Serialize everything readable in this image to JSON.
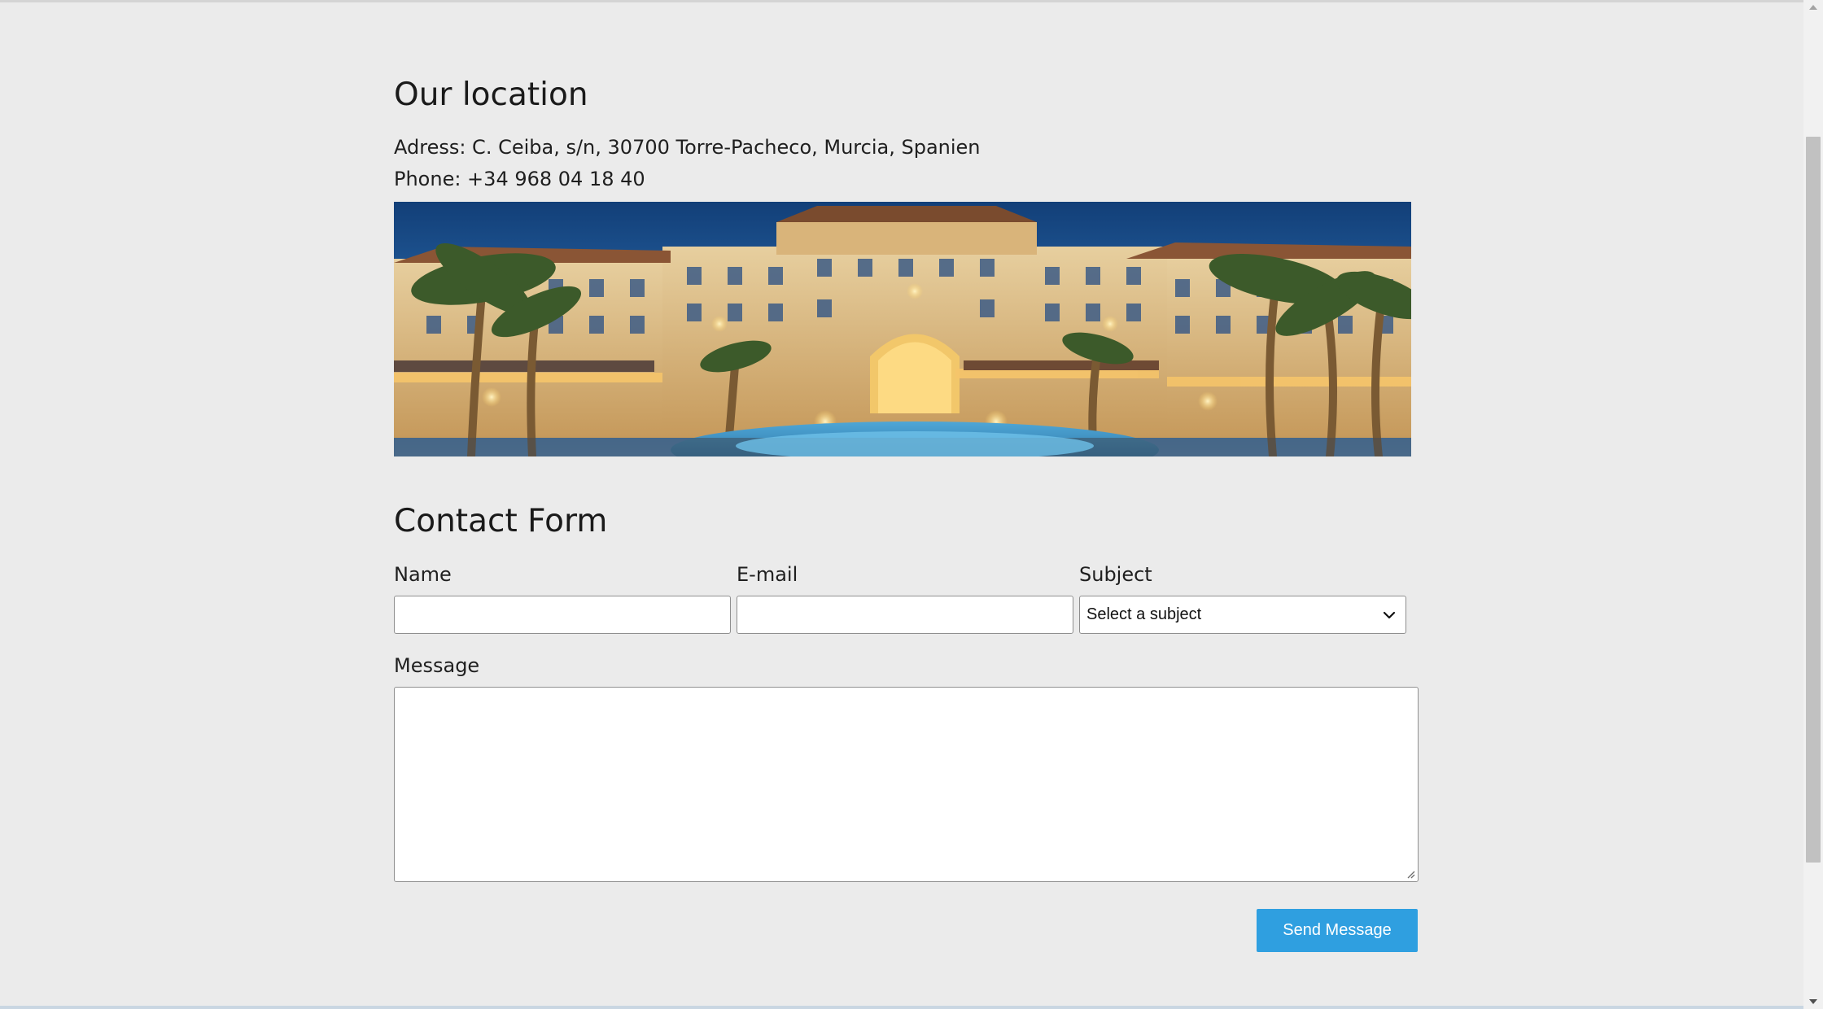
{
  "location": {
    "title": "Our location",
    "address": "Adress: C. Ceiba, s/n, 30700 Torre-Pacheco, Murcia, Spanien",
    "phone": "Phone: +34 968 04 18 40"
  },
  "contact_form": {
    "title": "Contact Form",
    "name_label": "Name",
    "email_label": "E-mail",
    "subject_label": "Subject",
    "subject_selected": "Select a subject",
    "message_label": "Message",
    "send_label": "Send Message"
  },
  "colors": {
    "page_background": "#ebebeb",
    "button_background": "#2f9fe0",
    "button_text": "#ffffff"
  }
}
